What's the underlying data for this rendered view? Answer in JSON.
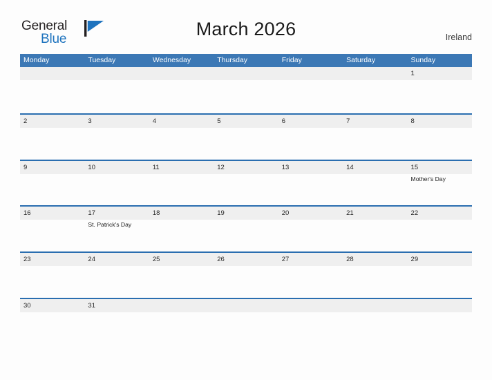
{
  "brand": {
    "word_one": "General",
    "word_two": "Blue",
    "mark_icon": "blue-pennant-flag-icon",
    "word_one_color": "#231f20",
    "word_two_color": "#1e73be",
    "mark_color": "#1e73be"
  },
  "header": {
    "title": "March 2026",
    "country": "Ireland"
  },
  "theme": {
    "header_blue": "#3c78b5",
    "row_border_blue": "#2a6eb0",
    "number_band_grey": "#efefef",
    "page_background": "#fdfdfd"
  },
  "calendar": {
    "weekday_headers": [
      "Monday",
      "Tuesday",
      "Wednesday",
      "Thursday",
      "Friday",
      "Saturday",
      "Sunday"
    ],
    "weeks": [
      [
        {
          "num": "",
          "event": ""
        },
        {
          "num": "",
          "event": ""
        },
        {
          "num": "",
          "event": ""
        },
        {
          "num": "",
          "event": ""
        },
        {
          "num": "",
          "event": ""
        },
        {
          "num": "",
          "event": ""
        },
        {
          "num": "1",
          "event": ""
        }
      ],
      [
        {
          "num": "2",
          "event": ""
        },
        {
          "num": "3",
          "event": ""
        },
        {
          "num": "4",
          "event": ""
        },
        {
          "num": "5",
          "event": ""
        },
        {
          "num": "6",
          "event": ""
        },
        {
          "num": "7",
          "event": ""
        },
        {
          "num": "8",
          "event": ""
        }
      ],
      [
        {
          "num": "9",
          "event": ""
        },
        {
          "num": "10",
          "event": ""
        },
        {
          "num": "11",
          "event": ""
        },
        {
          "num": "12",
          "event": ""
        },
        {
          "num": "13",
          "event": ""
        },
        {
          "num": "14",
          "event": ""
        },
        {
          "num": "15",
          "event": "Mother's Day"
        }
      ],
      [
        {
          "num": "16",
          "event": ""
        },
        {
          "num": "17",
          "event": "St. Patrick's Day"
        },
        {
          "num": "18",
          "event": ""
        },
        {
          "num": "19",
          "event": ""
        },
        {
          "num": "20",
          "event": ""
        },
        {
          "num": "21",
          "event": ""
        },
        {
          "num": "22",
          "event": ""
        }
      ],
      [
        {
          "num": "23",
          "event": ""
        },
        {
          "num": "24",
          "event": ""
        },
        {
          "num": "25",
          "event": ""
        },
        {
          "num": "26",
          "event": ""
        },
        {
          "num": "27",
          "event": ""
        },
        {
          "num": "28",
          "event": ""
        },
        {
          "num": "29",
          "event": ""
        }
      ],
      [
        {
          "num": "30",
          "event": ""
        },
        {
          "num": "31",
          "event": ""
        },
        {
          "num": "",
          "event": ""
        },
        {
          "num": "",
          "event": ""
        },
        {
          "num": "",
          "event": ""
        },
        {
          "num": "",
          "event": ""
        },
        {
          "num": "",
          "event": ""
        }
      ]
    ]
  }
}
